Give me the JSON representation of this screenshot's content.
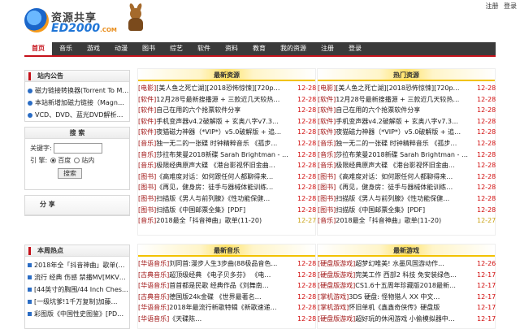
{
  "header": {
    "logo_cn": "资源共享",
    "logo_en": "ED2000",
    "logo_com": ".COM",
    "user_links": [
      "注册",
      "登录"
    ]
  },
  "nav": [
    "首页",
    "音乐",
    "游戏",
    "动漫",
    "图书",
    "综艺",
    "软件",
    "资料",
    "教育",
    "我的资源",
    "注册",
    "登录"
  ],
  "left": {
    "notice": {
      "title": "站内公告",
      "items": [
        "磁力链接转换器(Torrent To M…",
        "本站新增加磁力链接（Magn…",
        "VCD、DVD、蓝光DVD解析…"
      ]
    },
    "search": {
      "title": "搜 索",
      "keyword_label": "关键字:",
      "engine_label": "引 擎:",
      "opt1": "百度",
      "opt2": "站内",
      "button": "搜索"
    },
    "share": {
      "title": "分 享"
    },
    "hot": {
      "title": "本周热点",
      "items": [
        "2018年全「抖音神曲」歌单(…",
        "流行 经典 伤感 禁播MV[MKV…",
        "[44英寸的胸围/44 Inch Ches…",
        "[一级坑爹!1千万复制]加藤…",
        "彩图版《中国性史图鉴》[PD…"
      ]
    }
  },
  "latest": {
    "title": "最新资源",
    "rows": [
      {
        "cat": "[电影]",
        "txt": "[美人鱼之死亡湖][2018恐怖惊悚][720p…",
        "dt": "12-28"
      },
      {
        "cat": "[软件]",
        "txt": "12月28号最新搜播源 + 三款近几天较热…",
        "dt": "12-28"
      },
      {
        "cat": "[软件]",
        "txt": "自己在用的六个抢票软件分享",
        "dt": "12-28"
      },
      {
        "cat": "[软件]",
        "txt": "手机变声器v4.2破解版 + 玄奥八字v7.3…",
        "dt": "12-28"
      },
      {
        "cat": "[软件]",
        "txt": "夜猫磁力神器（*VIP*）v5.0破解版 + 追…",
        "dt": "12-28"
      },
      {
        "cat": "[音乐]",
        "txt": "独一无二的一张碟 时钟精粹音乐 《孤步…",
        "dt": "12-28"
      },
      {
        "cat": "[音乐]",
        "txt": "莎拉布莱曼2018新碟 Sarah Brightman - …",
        "dt": "12-28"
      },
      {
        "cat": "[音乐]",
        "txt": "极限经典原声大碟 《港台影视怀旧金曲…",
        "dt": "12-28"
      },
      {
        "cat": "[图书]",
        "txt": "《高难度对话：如何跟任何人都聊得来…",
        "dt": "12-28"
      },
      {
        "cat": "[图书]",
        "txt": "《再见，健身房：徒手与器械体能训练…",
        "dt": "12-28"
      },
      {
        "cat": "[图书]",
        "txt": "扫描版《男人与前列腺》《性功能保健…",
        "dt": "12-28"
      },
      {
        "cat": "[图书]",
        "txt": "扫描版《中国邮票全集》[PDF]",
        "dt": "12-28"
      },
      {
        "cat": "[音乐]",
        "txt": "2018最全「抖音神曲」歌单(11-20)",
        "dt": "12-27",
        "dim": true
      }
    ]
  },
  "popular": {
    "title": "热门资源",
    "rows": [
      {
        "cat": "[电影]",
        "txt": "[美人鱼之死亡湖][2018恐怖惊悚][720p…",
        "dt": "12-28"
      },
      {
        "cat": "[软件]",
        "txt": "12月28号最新搜播源 + 三款近几天较热…",
        "dt": "12-28"
      },
      {
        "cat": "[软件]",
        "txt": "自己在用的六个抢票软件分享",
        "dt": "12-28"
      },
      {
        "cat": "[软件]",
        "txt": "手机变声器v4.2破解版 + 玄奥八字v7.3…",
        "dt": "12-28"
      },
      {
        "cat": "[软件]",
        "txt": "夜猫磁力神器（*VIP*）v5.0破解版 + 追…",
        "dt": "12-28"
      },
      {
        "cat": "[音乐]",
        "txt": "独一无二的一张碟 时钟精粹音乐 《孤步…",
        "dt": "12-28"
      },
      {
        "cat": "[音乐]",
        "txt": "莎拉布莱曼2018新碟 Sarah Brightman - …",
        "dt": "12-28"
      },
      {
        "cat": "[音乐]",
        "txt": "极限经典原声大碟 《港台影视怀旧金曲…",
        "dt": "12-28"
      },
      {
        "cat": "[图书]",
        "txt": "《高难度对话：如何跟任何人都聊得来…",
        "dt": "12-28"
      },
      {
        "cat": "[图书]",
        "txt": "《再见，健身房：徒手与器械体能训练…",
        "dt": "12-28"
      },
      {
        "cat": "[图书]",
        "txt": "扫描版《男人与前列腺》《性功能保健…",
        "dt": "12-28"
      },
      {
        "cat": "[图书]",
        "txt": "扫描版《中国邮票全集》[PDF]",
        "dt": "12-28"
      },
      {
        "cat": "[音乐]",
        "txt": "2018最全「抖音神曲」歌单(11-20)",
        "dt": "12-27",
        "dim": true
      }
    ]
  },
  "music": {
    "title": "最新音乐",
    "rows": [
      {
        "cat": "[华语音乐]",
        "txt": "刘同首:漫步人生3步曲(88极品音色…",
        "dt": "12-28"
      },
      {
        "cat": "[古典音乐]",
        "txt": "超顶级经典 《电子贝多芬》 《电…",
        "dt": "12-28"
      },
      {
        "cat": "[华语音乐]",
        "txt": "首首都是民歌 经典作品《刘舞南…",
        "dt": "12-28"
      },
      {
        "cat": "[古典音乐]",
        "txt": "德国版24k金碟 《世界最著名…",
        "dt": "12-28"
      },
      {
        "cat": "[华语音乐]",
        "txt": "2018年最流行新歌特辑《新歌速递…",
        "dt": "12-28"
      },
      {
        "cat": "[华语音乐]",
        "txt": "《天碟陈…",
        "dt": "12-28"
      }
    ]
  },
  "games": {
    "title": "最新游戏",
    "rows": [
      {
        "cat": "[硬盘版游戏]",
        "txt": "超梦幻唯美! 水墨风国游动作…",
        "dt": "12-26"
      },
      {
        "cat": "[硬盘版游戏]",
        "txt": "完美工作 西部2 科技 免安装绿色…",
        "dt": "12-17"
      },
      {
        "cat": "[硬盘版游戏]",
        "txt": "CS1.6十五周年珍藏版2018最新…",
        "dt": "12-17"
      },
      {
        "cat": "[掌机游戏]",
        "txt": "3DS 硬盘: 怪物猎人 XX 中文…",
        "dt": "12-17"
      },
      {
        "cat": "[掌机游戏]",
        "txt": "怀旧单机《鑫鑫奇侠传》硬盘版",
        "dt": "12-17"
      },
      {
        "cat": "[硬盘版游戏]",
        "txt": "超好玩的休闲游戏 小偷模拟器中…",
        "dt": "12-17"
      }
    ]
  }
}
